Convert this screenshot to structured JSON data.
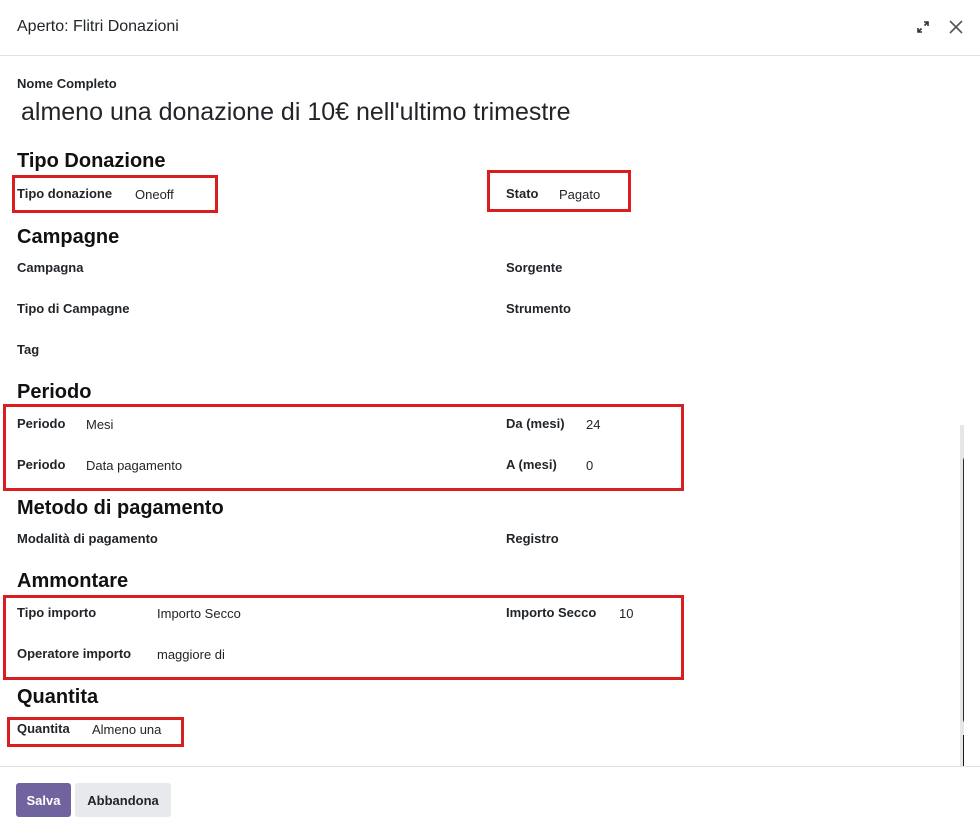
{
  "dialog": {
    "title": "Aperto: Flitri Donazioni",
    "name_label": "Nome Completo",
    "name_value": "almeno una donazione di 10€ nell'ultimo trimestre"
  },
  "sections": {
    "tipo_donazione": "Tipo Donazione",
    "campagne": "Campagne",
    "periodo": "Periodo",
    "metodo": "Metodo di pagamento",
    "ammontare": "Ammontare",
    "quantita": "Quantita"
  },
  "fields": {
    "tipo_donazione_label": "Tipo donazione",
    "tipo_donazione_value": "Oneoff",
    "stato_label": "Stato",
    "stato_value": "Pagato",
    "campagna_label": "Campagna",
    "sorgente_label": "Sorgente",
    "tipo_campagne_label": "Tipo di Campagne",
    "strumento_label": "Strumento",
    "tag_label": "Tag",
    "periodo1_label": "Periodo",
    "periodo1_value": "Mesi",
    "da_label": "Da (mesi)",
    "da_value": "24",
    "periodo2_label": "Periodo",
    "periodo2_value": "Data pagamento",
    "a_label": "A (mesi)",
    "a_value": "0",
    "modalita_label": "Modalità di pagamento",
    "registro_label": "Registro",
    "tipo_importo_label": "Tipo importo",
    "tipo_importo_value": "Importo Secco",
    "importo_secco_label": "Importo Secco",
    "importo_secco_value": "10",
    "operatore_label": "Operatore importo",
    "operatore_value": "maggiore di",
    "quantita_label": "Quantita",
    "quantita_value": "Almeno una"
  },
  "footer": {
    "save_label": "Salva",
    "discard_label": "Abbandona"
  },
  "colors": {
    "primary": "#71639e",
    "highlight": "#d81e1e"
  },
  "icons": {
    "expand": "expand-icon",
    "close": "close-icon"
  }
}
